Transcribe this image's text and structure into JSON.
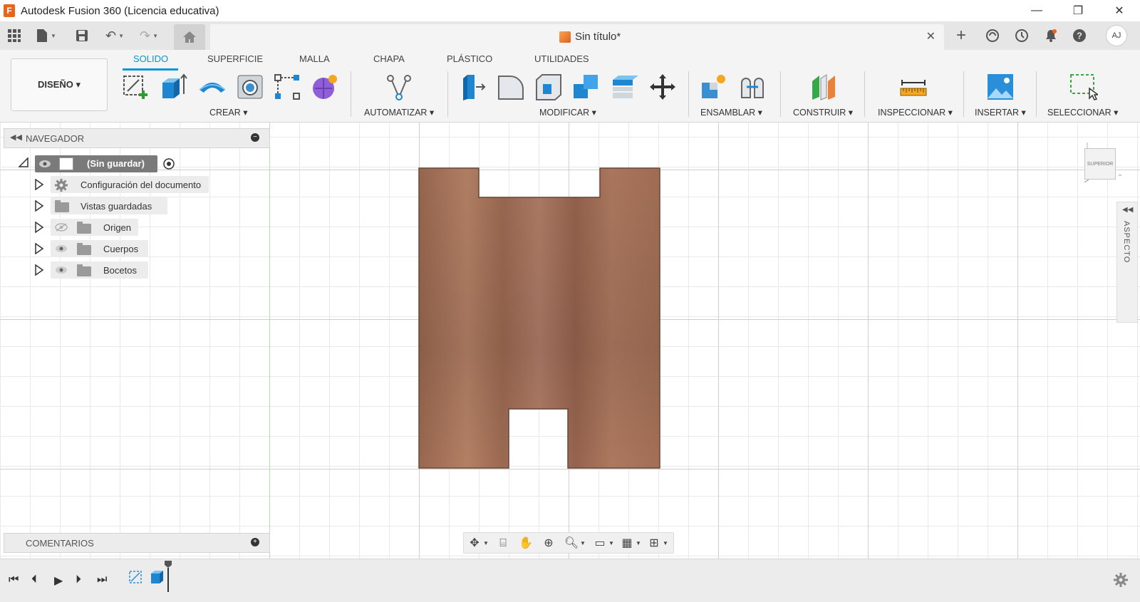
{
  "window": {
    "title": "Autodesk Fusion 360 (Licencia educativa)",
    "minimize": "—",
    "restore": "❐",
    "close": "✕"
  },
  "document": {
    "title": "Sin título*",
    "close": "✕"
  },
  "user": {
    "initials": "AJ"
  },
  "workspace": {
    "label": "DISEÑO ▾"
  },
  "ribbon_tabs": [
    "SOLIDO",
    "SUPERFICIE",
    "MALLA",
    "CHAPA",
    "PLÁSTICO",
    "UTILIDADES"
  ],
  "groups": {
    "crear": "CREAR ▾",
    "automatizar": "AUTOMATIZAR ▾",
    "modificar": "MODIFICAR ▾",
    "ensamblar": "ENSAMBLAR ▾",
    "construir": "CONSTRUIR ▾",
    "inspeccionar": "INSPECCIONAR ▾",
    "insertar": "INSERTAR ▾",
    "seleccionar": "SELECCIONAR ▾"
  },
  "navigator": {
    "title": "NAVEGADOR",
    "root": "(Sin guardar)",
    "items": [
      {
        "label": "Configuración del documento"
      },
      {
        "label": "Vistas guardadas"
      },
      {
        "label": "Origen"
      },
      {
        "label": "Cuerpos"
      },
      {
        "label": "Bocetos"
      }
    ]
  },
  "comments": {
    "title": "COMENTARIOS"
  },
  "viewcube": {
    "face": "SUPERIOR"
  },
  "side_panel": {
    "label": "ASPECTO"
  },
  "colors": {
    "accent": "#0696d7",
    "wood": "#a8735a",
    "toolbar_bg": "#f4f4f4"
  }
}
